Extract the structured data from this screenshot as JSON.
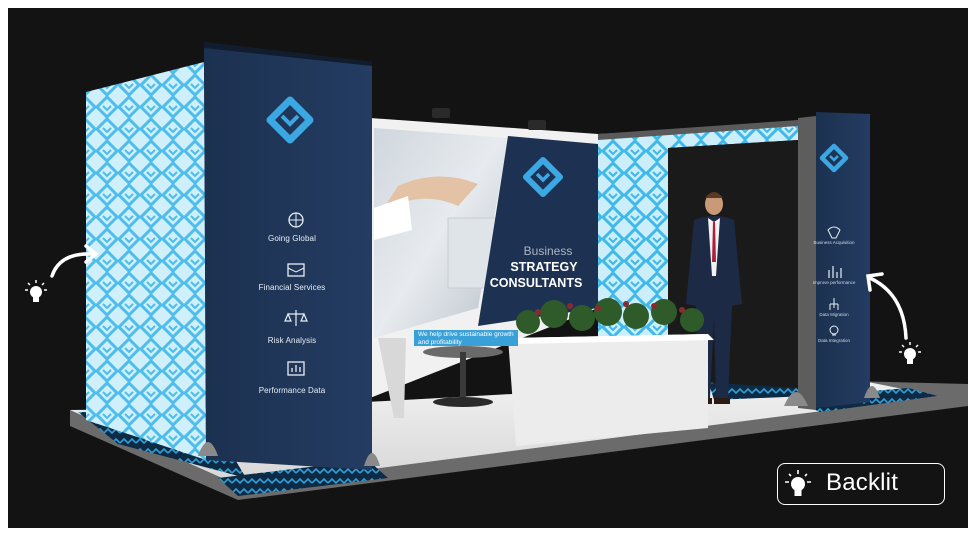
{
  "booth": {
    "left_tower": {
      "services": [
        {
          "label": "Going Global",
          "icon": "globe-icon"
        },
        {
          "label": "Financial Services",
          "icon": "briefcase-icon"
        },
        {
          "label": "Risk Analysis",
          "icon": "scales-icon"
        },
        {
          "label": "Performance Data",
          "icon": "presentation-chart-icon"
        }
      ]
    },
    "centre_panel": {
      "kicker": "Business",
      "title_line1": "STRATEGY",
      "title_line2": "CONSULTANTS",
      "tagline": "We help drive sustainable growth and profitability"
    },
    "right_tower": {
      "services": [
        {
          "label": "Business Acquisition",
          "icon": "handshake-icon"
        },
        {
          "label": "Improve performance",
          "icon": "bar-chart-icon"
        },
        {
          "label": "Data Migration",
          "icon": "flow-icon"
        },
        {
          "label": "Data Integration",
          "icon": "lightbulb-icon"
        }
      ]
    }
  },
  "legend": {
    "label": "Backlit",
    "icon": "lightbulb-icon"
  },
  "colors": {
    "background": "#131313",
    "panel_navy": "#1f3556",
    "pattern_blue": "#5cc8ef",
    "pattern_light": "#d6f1fb",
    "accent_blue": "#3aa0d8"
  }
}
